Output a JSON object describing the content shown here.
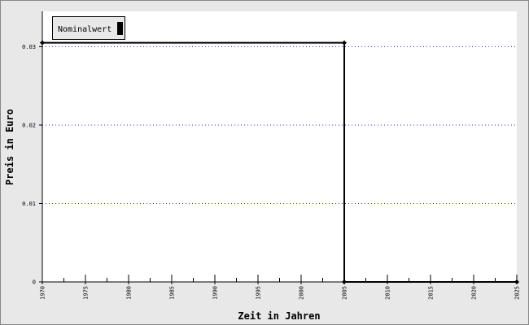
{
  "chart_data": {
    "type": "line",
    "step": true,
    "xlabel": "Zeit in Jahren",
    "ylabel": "Preis in Euro",
    "xlim": [
      1970,
      2025
    ],
    "ylim": [
      0,
      0.0345
    ],
    "x_ticks": [
      1970,
      1975,
      1980,
      1985,
      1990,
      1995,
      2000,
      2005,
      2010,
      2015,
      2020,
      2025
    ],
    "x_tick_labels": [
      "1970",
      "1975",
      "1980",
      "1985",
      "1990",
      "1995",
      "2000",
      "2005",
      "2010",
      "2015",
      "2020",
      "2025"
    ],
    "y_ticks": [
      0,
      0.01,
      0.02,
      0.03
    ],
    "y_tick_labels": [
      "0",
      "0.01",
      "0.02",
      "0.03"
    ],
    "grid": "horizontal dotted",
    "grid_color": "#3333cc",
    "legend_position": "top-left",
    "series": [
      {
        "name": "Nominalwert",
        "color": "#000000",
        "points": [
          {
            "x": 1970,
            "y": 0.0305
          },
          {
            "x": 2005,
            "y": 0.0305
          },
          {
            "x": 2005,
            "y": 0
          },
          {
            "x": 2025,
            "y": 0
          }
        ]
      }
    ]
  }
}
